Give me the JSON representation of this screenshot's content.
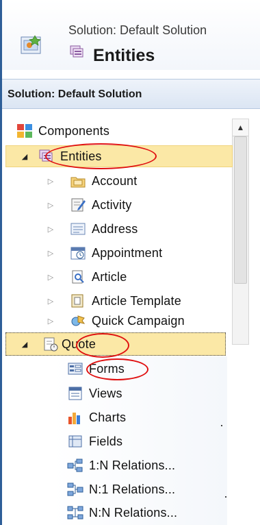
{
  "header": {
    "subtitle": "Solution: Default Solution",
    "title": "Entities"
  },
  "solution_panel": {
    "title": "Solution: Default Solution"
  },
  "tree": {
    "components": "Components",
    "entities": "Entities",
    "entity_items": [
      {
        "label": "Account",
        "icon": "account-icon"
      },
      {
        "label": "Activity",
        "icon": "activity-icon"
      },
      {
        "label": "Address",
        "icon": "address-icon"
      },
      {
        "label": "Appointment",
        "icon": "appointment-icon"
      },
      {
        "label": "Article",
        "icon": "article-icon"
      },
      {
        "label": "Article Template",
        "icon": "article-template-icon"
      },
      {
        "label": "Quick Campaign",
        "icon": "quick-campaign-icon"
      }
    ],
    "quote": "Quote",
    "quote_items": [
      {
        "label": "Forms",
        "icon": "forms-icon"
      },
      {
        "label": "Views",
        "icon": "views-icon"
      },
      {
        "label": "Charts",
        "icon": "charts-icon"
      },
      {
        "label": "Fields",
        "icon": "fields-icon"
      },
      {
        "label": "1:N Relations...",
        "icon": "relation-1n-icon"
      },
      {
        "label": "N:1 Relations...",
        "icon": "relation-n1-icon"
      },
      {
        "label": "N:N Relations...",
        "icon": "relation-nn-icon"
      }
    ]
  },
  "colors": {
    "highlight": "#fbe8a6",
    "annotation": "#e01010",
    "frame": "#2f5f98"
  }
}
